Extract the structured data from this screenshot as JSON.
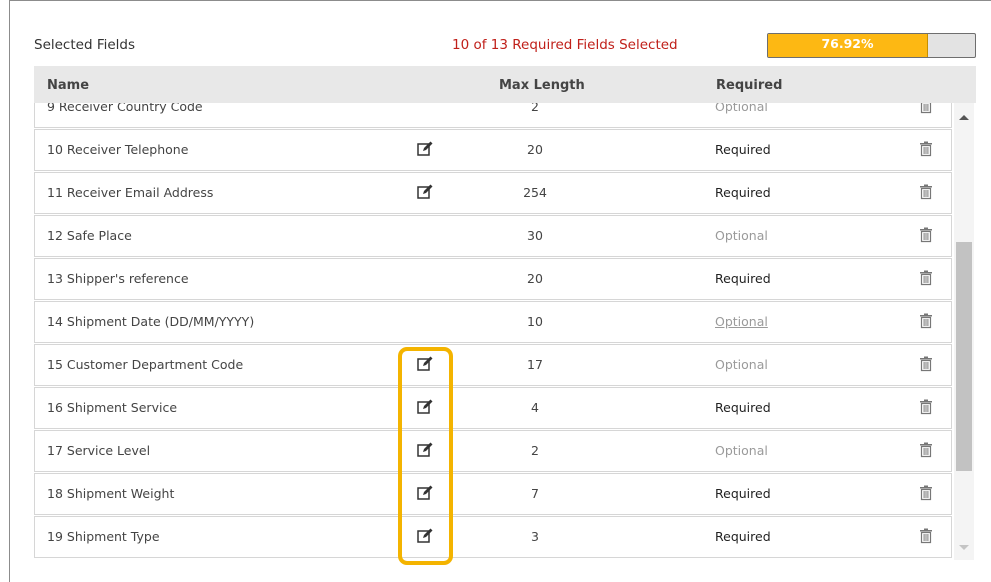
{
  "panel": {
    "title": "Selected Fields",
    "summary": "10 of 13 Required Fields Selected",
    "progress": {
      "percent_label": "76.92%",
      "fraction": 0.7692
    }
  },
  "table": {
    "headers": {
      "name": "Name",
      "max_length": "Max Length",
      "required": "Required"
    },
    "rows": [
      {
        "name": "9 Receiver Country Code",
        "max": "2",
        "required": "Optional",
        "editable": false,
        "status": "optional",
        "link": false
      },
      {
        "name": "10 Receiver Telephone",
        "max": "20",
        "required": "Required",
        "editable": true,
        "status": "required",
        "link": false
      },
      {
        "name": "11 Receiver Email Address",
        "max": "254",
        "required": "Required",
        "editable": true,
        "status": "required",
        "link": false
      },
      {
        "name": "12 Safe Place",
        "max": "30",
        "required": "Optional",
        "editable": false,
        "status": "optional",
        "link": false
      },
      {
        "name": "13 Shipper's reference",
        "max": "20",
        "required": "Required",
        "editable": false,
        "status": "required",
        "link": false
      },
      {
        "name": "14 Shipment Date (DD/MM/YYYY)",
        "max": "10",
        "required": "Optional",
        "editable": false,
        "status": "optional",
        "link": true
      },
      {
        "name": "15 Customer Department Code",
        "max": "17",
        "required": "Optional",
        "editable": true,
        "status": "optional",
        "link": false
      },
      {
        "name": "16 Shipment Service",
        "max": "4",
        "required": "Required",
        "editable": true,
        "status": "required",
        "link": false
      },
      {
        "name": "17 Service Level",
        "max": "2",
        "required": "Optional",
        "editable": true,
        "status": "optional",
        "link": false
      },
      {
        "name": "18 Shipment Weight",
        "max": "7",
        "required": "Required",
        "editable": true,
        "status": "required",
        "link": false
      },
      {
        "name": "19 Shipment Type",
        "max": "3",
        "required": "Required",
        "editable": true,
        "status": "required",
        "link": false
      }
    ]
  },
  "scrollbar": {
    "position": 0.62,
    "visible_fraction": 0.55
  },
  "icons": {
    "edit": "edit-icon",
    "delete": "trash-icon"
  },
  "colors": {
    "accent": "#fdb813",
    "summary_text": "#c0201a",
    "highlight": "#f4b400",
    "header_bg": "#e8e8e8"
  }
}
